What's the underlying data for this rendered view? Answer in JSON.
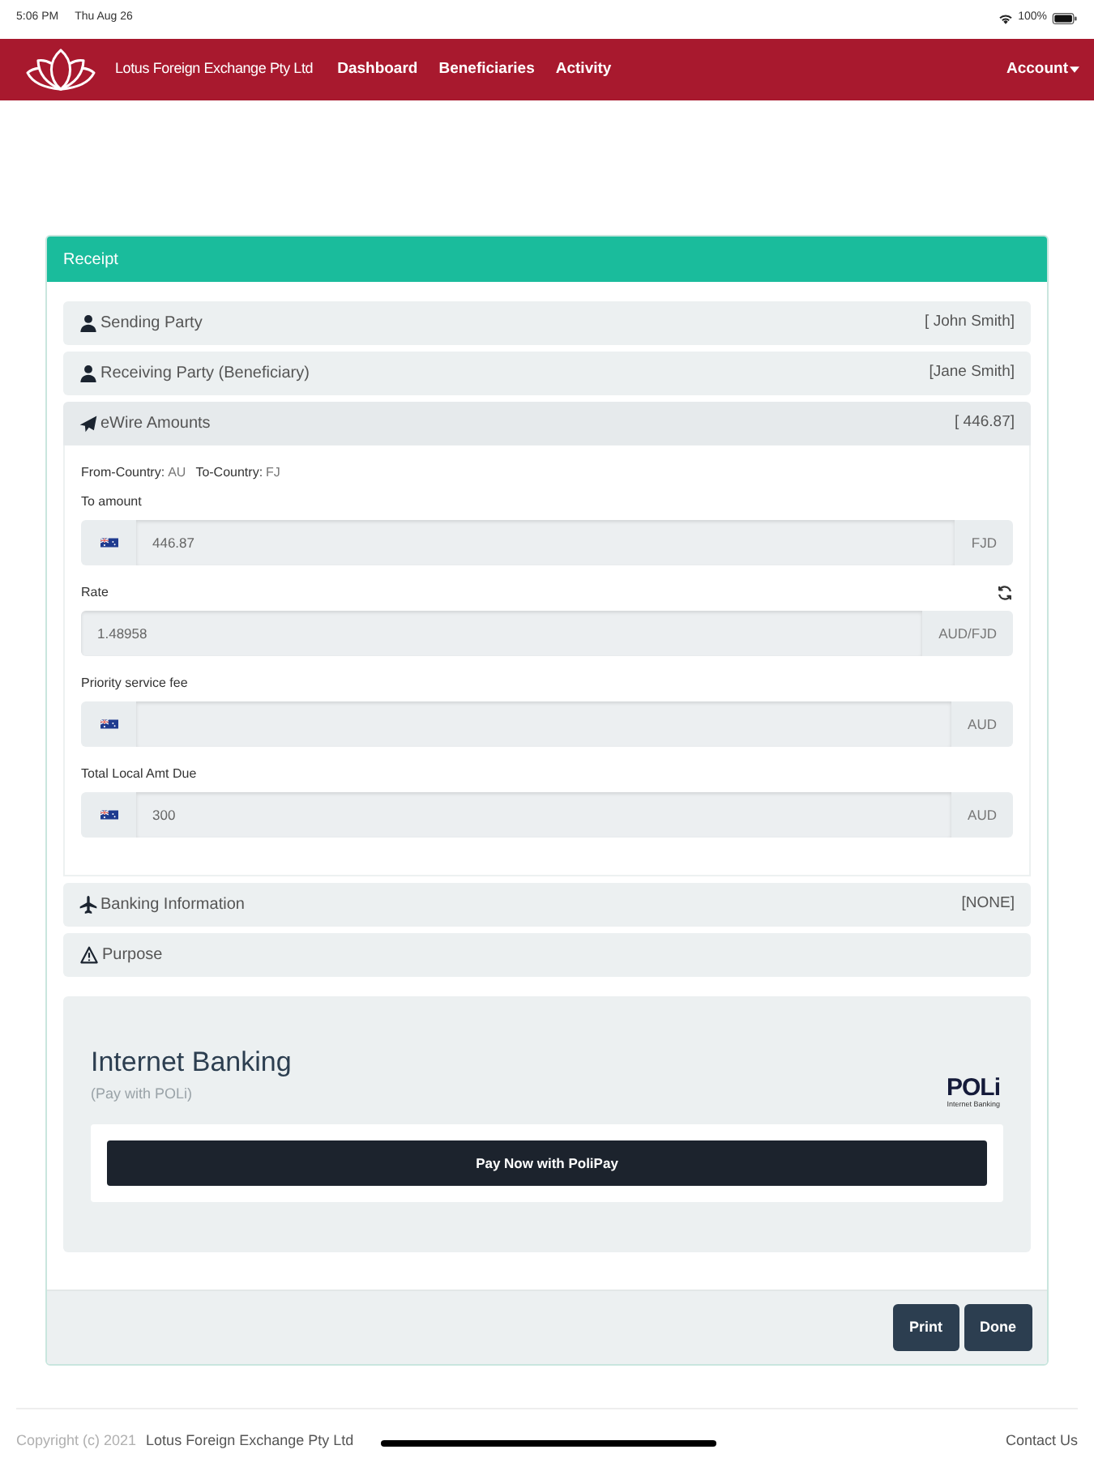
{
  "status_bar": {
    "time": "5:06 PM",
    "date": "Thu Aug 26",
    "battery": "100%"
  },
  "navbar": {
    "brand": "Lotus Foreign Exchange Pty Ltd",
    "links": [
      "Dashboard",
      "Beneficiaries",
      "Activity"
    ],
    "account": "Account"
  },
  "receipt": {
    "title": "Receipt",
    "sections": [
      {
        "kind": "person",
        "label": "Sending Party",
        "value": "[ John Smith]",
        "expanded": false
      },
      {
        "kind": "person",
        "label": "Receiving Party (Beneficiary)",
        "value": "[Jane Smith]",
        "expanded": false
      },
      {
        "kind": "amounts",
        "label": "eWire Amounts",
        "value": "[ 446.87]",
        "expanded": true,
        "details": {
          "countries": [
            {
              "label": "From-Country:",
              "value": "AU"
            },
            {
              "label": "To-Country:",
              "value": "FJ"
            }
          ],
          "fields": [
            {
              "label": "To amount",
              "flag": true,
              "value": "446.87",
              "unit": "FJD",
              "refresh": false
            },
            {
              "label": "Rate",
              "flag": false,
              "value": "1.48958",
              "unit": "AUD/FJD",
              "refresh": true
            },
            {
              "label": "Priority service fee",
              "flag": true,
              "unit": "AUD",
              "refresh": false
            },
            {
              "label": "Total Local Amt Due",
              "flag": true,
              "value": "300",
              "unit": "AUD",
              "refresh": false
            }
          ]
        }
      },
      {
        "kind": "banking",
        "label": "Banking Information",
        "value": "[NONE]",
        "expanded": false
      },
      {
        "kind": "purpose",
        "label": "Purpose",
        "expanded": false
      }
    ],
    "payment": {
      "title": "Internet Banking",
      "subtitle": "(Pay with POLi)",
      "logo_text": "POLi",
      "logo_caption": "Internet Banking",
      "button": "Pay Now with PoliPay"
    },
    "buttons": [
      "Print",
      "Done"
    ]
  },
  "footer": {
    "copyright": "Copyright (c) 2021",
    "company": "Lotus Foreign Exchange Pty Ltd",
    "link": "Contact Us"
  }
}
